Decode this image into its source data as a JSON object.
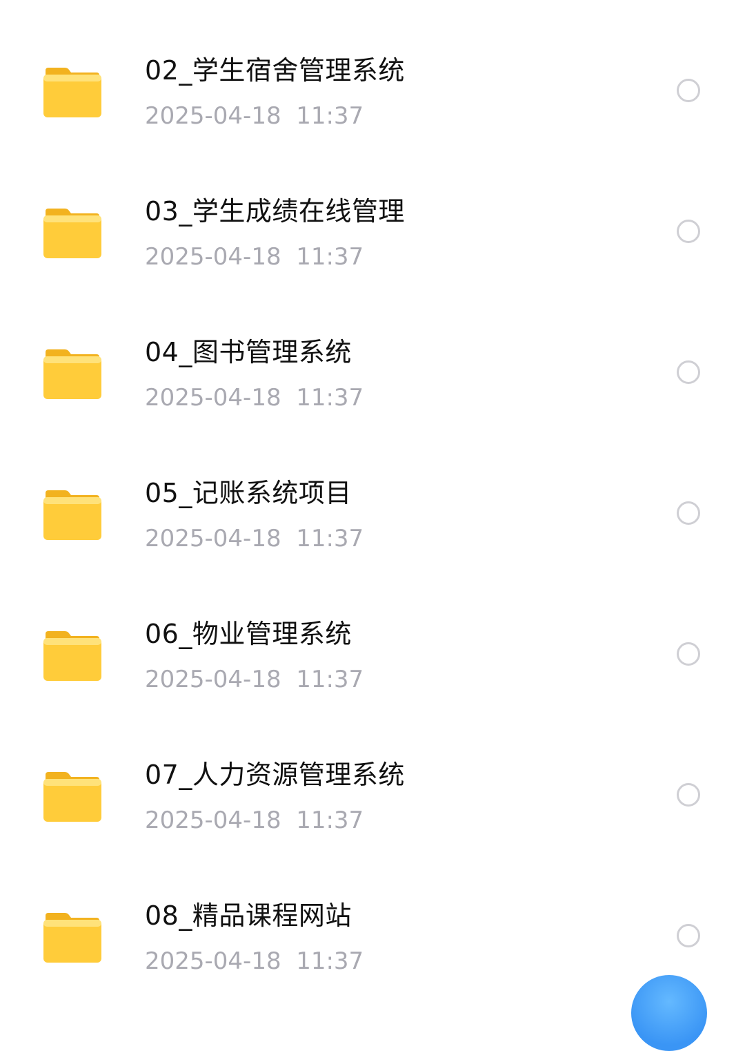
{
  "file_list": {
    "items": [
      {
        "name": "02_学生宿舍管理系统",
        "date": "2025-04-18  11:37",
        "icon": "folder-icon",
        "selected": false
      },
      {
        "name": "03_学生成绩在线管理",
        "date": "2025-04-18  11:37",
        "icon": "folder-icon",
        "selected": false
      },
      {
        "name": "04_图书管理系统",
        "date": "2025-04-18  11:37",
        "icon": "folder-icon",
        "selected": false
      },
      {
        "name": "05_记账系统项目",
        "date": "2025-04-18  11:37",
        "icon": "folder-icon",
        "selected": false
      },
      {
        "name": "06_物业管理系统",
        "date": "2025-04-18  11:37",
        "icon": "folder-icon",
        "selected": false
      },
      {
        "name": "07_人力资源管理系统",
        "date": "2025-04-18  11:37",
        "icon": "folder-icon",
        "selected": false
      },
      {
        "name": "08_精品课程网站",
        "date": "2025-04-18  11:37",
        "icon": "folder-icon",
        "selected": false
      }
    ]
  },
  "colors": {
    "folder": "#FFCC3A",
    "name_text": "#111111",
    "date_text": "#A9A9B1",
    "radio_border": "#CFCFD4",
    "fab": "#3A95F5"
  },
  "fab": {
    "icon": "fab-icon"
  }
}
